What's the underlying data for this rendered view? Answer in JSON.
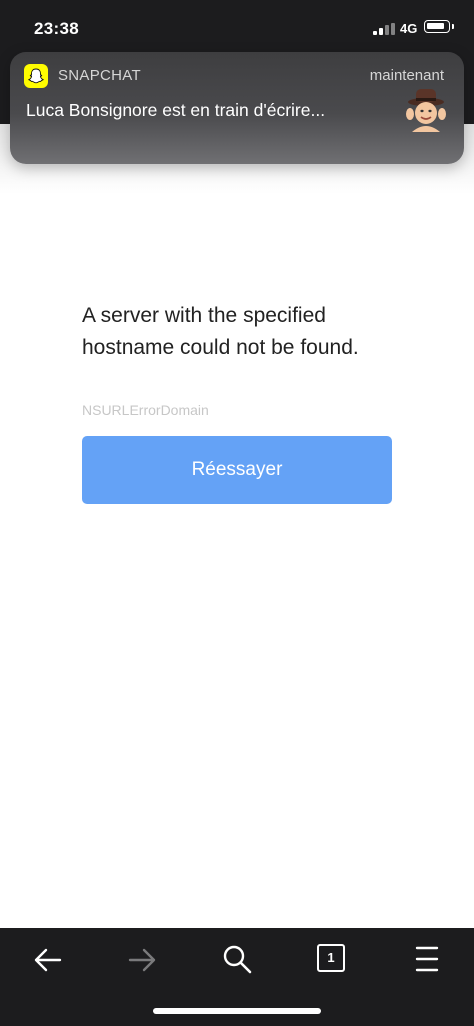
{
  "status_bar": {
    "time": "23:38",
    "network": "4G"
  },
  "notification": {
    "app_name": "SNAPCHAT",
    "time": "maintenant",
    "message": "Luca Bonsignore est en train d'écrire...",
    "app_icon": "snapchat-ghost-icon",
    "avatar": "bitmoji-avatar"
  },
  "error": {
    "message": "A server with the specified hostname could not be found.",
    "domain": "NSURLErrorDomain",
    "retry_label": "Réessayer"
  },
  "toolbar": {
    "back_icon": "arrow-left-icon",
    "forward_icon": "arrow-right-icon",
    "search_icon": "search-icon",
    "tab_count": "1",
    "menu_icon": "menu-icon"
  },
  "colors": {
    "button": "#64a2f6",
    "toolbar": "#1c1c1e",
    "snapchat_yellow": "#fffc00"
  }
}
